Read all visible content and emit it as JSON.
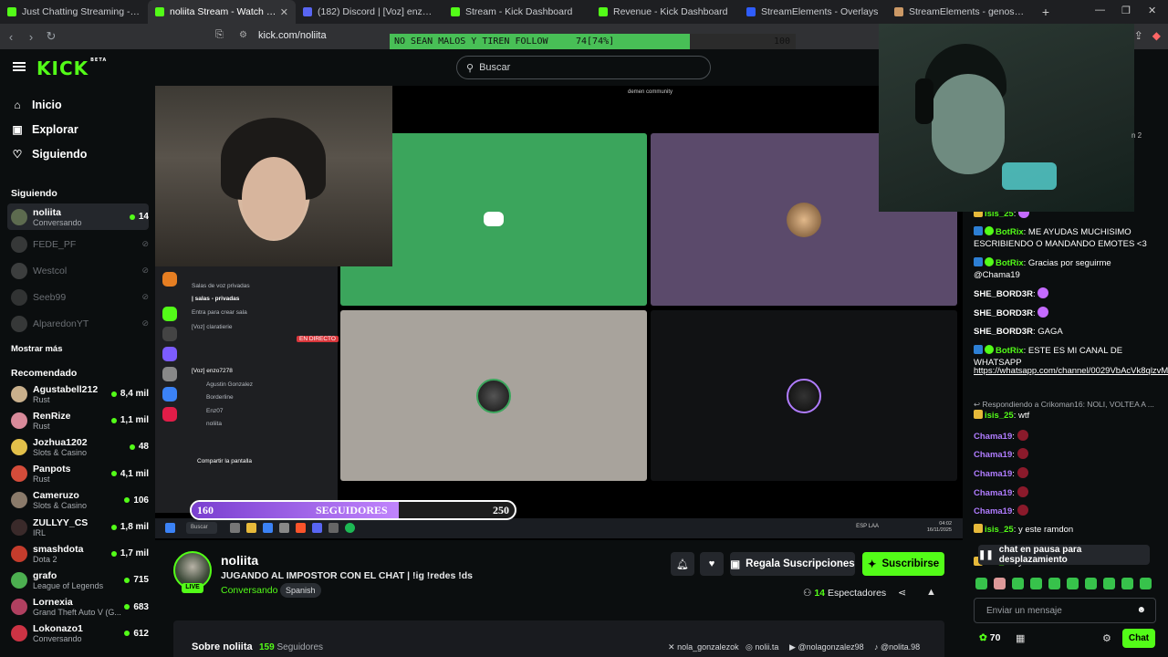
{
  "browser": {
    "tabs": [
      {
        "title": "Just Chatting Streaming - Live Strea",
        "color": "#53fc18"
      },
      {
        "title": "noliita Stream - Watch Live on Ki",
        "color": "#53fc18"
      },
      {
        "title": "(182) Discord | [Voz] enzo7278 |",
        "color": "#5865f2"
      },
      {
        "title": "Stream - Kick Dashboard",
        "color": "#53fc18"
      },
      {
        "title": "Revenue - Kick Dashboard",
        "color": "#53fc18"
      },
      {
        "title": "StreamElements - Overlays",
        "color": "#2f5dfc"
      },
      {
        "title": "StreamElements - genos201",
        "color": "#c96"
      }
    ],
    "url": "kick.com/noliita"
  },
  "goal_bar": {
    "label": "NO SEAN MALOS Y TIREN FOLLOW",
    "current": "74[74%]",
    "target": "100",
    "progress": 0.74
  },
  "header": {
    "search_placeholder": "Buscar"
  },
  "sidebar": {
    "nav": [
      {
        "label": "Inicio",
        "icon": "home-icon"
      },
      {
        "label": "Explorar",
        "icon": "compass-icon"
      },
      {
        "label": "Siguiendo",
        "icon": "heart-icon"
      }
    ],
    "following_title": "Siguiendo",
    "following": [
      {
        "name": "noliita",
        "category": "Conversando",
        "viewers": "14",
        "live": true,
        "color": "#5d6b4f"
      },
      {
        "name": "FEDE_PF",
        "live": false,
        "color": "#888"
      },
      {
        "name": "Westcol",
        "live": false,
        "color": "#999"
      },
      {
        "name": "Seeb99",
        "live": false,
        "color": "#777"
      },
      {
        "name": "AlparedonYT",
        "live": false,
        "color": "#888"
      }
    ],
    "show_more": "Mostrar más",
    "recommended_title": "Recomendado",
    "recommended": [
      {
        "name": "Agustabell212",
        "category": "Rust",
        "viewers": "8,4 mil",
        "color": "#c9b08c"
      },
      {
        "name": "RenRize",
        "category": "Rust",
        "viewers": "1,1 mil",
        "color": "#d88a9a"
      },
      {
        "name": "Jozhua1202",
        "category": "Slots & Casino",
        "viewers": "48",
        "color": "#e2c04a"
      },
      {
        "name": "Panpots",
        "category": "Rust",
        "viewers": "4,1 mil",
        "color": "#d44c3a"
      },
      {
        "name": "Cameruzo",
        "category": "Slots & Casino",
        "viewers": "106",
        "color": "#8a7a6a"
      },
      {
        "name": "ZULLYY_CS",
        "category": "IRL",
        "viewers": "1,8 mil",
        "color": "#3a2a2a"
      },
      {
        "name": "smashdota",
        "category": "Dota 2",
        "viewers": "1,7 mil",
        "color": "#c43c2c"
      },
      {
        "name": "grafo",
        "category": "League of Legends",
        "viewers": "715",
        "color": "#4caf50"
      },
      {
        "name": "Lornexia",
        "category": "Grand Theft Auto V (G...",
        "viewers": "683",
        "color": "#b04060"
      },
      {
        "name": "Lokonazo1",
        "category": "Conversando",
        "viewers": "612",
        "color": "#cc3344"
      }
    ]
  },
  "video": {
    "discord_title": "demen community",
    "discord_channels": [
      "Salas de voz privadas",
      "| salas - privadas",
      "Entra para crear sala",
      "[Voz] claratierie",
      "[Voz] enzo7278",
      "Agustin Gonzalez",
      "Borderline",
      "Enz07",
      "noliita",
      "Compartir la pantalla",
      "EN DIRECTO"
    ],
    "follower_goal": {
      "current": "160",
      "label": "SEGUIDORES",
      "target": "250",
      "progress": 0.64
    },
    "taskbar": {
      "search": "Buscar",
      "clock_time": "04:02",
      "clock_date": "16/11/2025",
      "lang": "ESP LAA"
    }
  },
  "stream": {
    "name": "noliita",
    "title": "JUGANDO AL IMPOSTOR CON EL CHAT | !ig !redes !ds",
    "category": "Conversando",
    "language": "Spanish",
    "live_badge": "LIVE",
    "gift_label": "Regala Suscripciones",
    "subscribe_label": "Suscribirse",
    "viewers_count": "14",
    "viewers_label": "Espectadores",
    "about_title": "Sobre noliita",
    "followers_count": "159",
    "followers_label": "Seguidores",
    "socials": [
      {
        "handle": "nola_gonzalezok",
        "icon": "x-icon"
      },
      {
        "handle": "nolii.ta",
        "icon": "instagram-icon"
      },
      {
        "handle": "@nolagonzalez98",
        "icon": "youtube-icon"
      },
      {
        "handle": "@nolita.98",
        "icon": "tiktok-icon"
      }
    ]
  },
  "chat": {
    "header_fragment": "n 2",
    "messages": [
      {
        "user": "isis_25",
        "text": "",
        "color": "#53fc18"
      },
      {
        "user": "BotRix",
        "text": "ME AYUDAS MUCHISIMO ESCRIBIENDO O MANDANDO EMOTES <3",
        "color": "#53fc18"
      },
      {
        "user": "BotRix",
        "text": "Gracias por seguirme @Chama19",
        "color": "#53fc18"
      },
      {
        "user": "SHE_BORD3R",
        "text": "",
        "color": "#fff"
      },
      {
        "user": "SHE_BORD3R",
        "text": "",
        "color": "#fff"
      },
      {
        "user": "SHE_BORD3R",
        "text": "GAGA",
        "color": "#fff"
      },
      {
        "user": "BotRix",
        "text": "ESTE ES MI CANAL DE WHATSAPP",
        "color": "#53fc18"
      },
      {
        "user": "",
        "text": "https://whatsapp.com/channel/0029VbAcVk8qlzvM1sjO900",
        "color": "#fff"
      },
      {
        "user": "isis_25",
        "text": "wtf",
        "color": "#53fc18"
      },
      {
        "user": "Chama19",
        "text": "",
        "color": "#b07cff"
      },
      {
        "user": "Chama19",
        "text": "",
        "color": "#b07cff"
      },
      {
        "user": "Chama19",
        "text": "",
        "color": "#b07cff"
      },
      {
        "user": "Chama19",
        "text": "",
        "color": "#b07cff"
      },
      {
        "user": "Chama19",
        "text": "",
        "color": "#b07cff"
      },
      {
        "user": "isis_25",
        "text": "y este ramdon",
        "color": "#53fc18"
      },
      {
        "user": "isis_25",
        "text": "y este",
        "color": "#53fc18"
      }
    ],
    "reply_label": "Respondiendo a Crikoman16: NOLI, VOLTEA A ...",
    "paused_label": "chat en pausa para desplazamiento",
    "input_placeholder": "Enviar un mensaje",
    "points": "70",
    "send_label": "Chat"
  }
}
